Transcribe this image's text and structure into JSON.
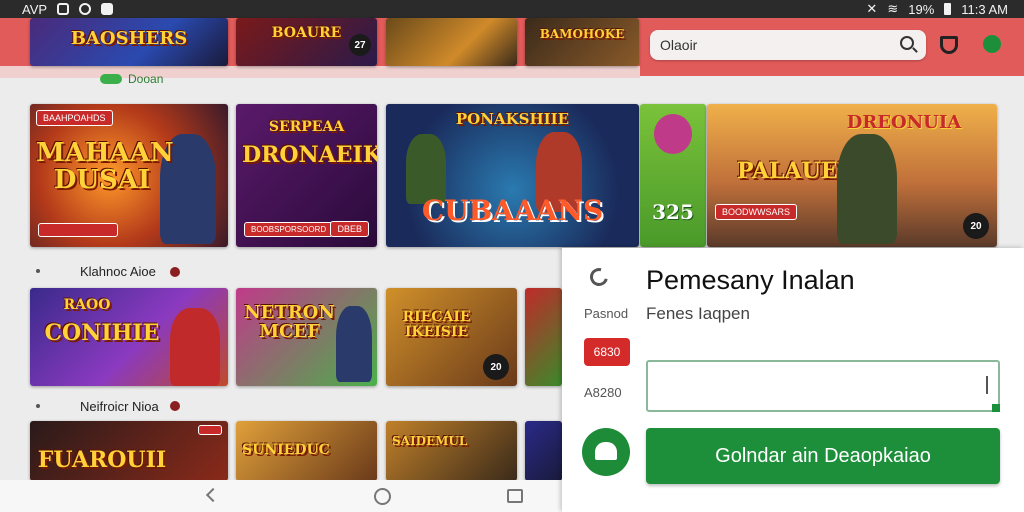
{
  "status_bar": {
    "carrier": "AVP",
    "battery": "19%",
    "time": "11:3 AM"
  },
  "header": {
    "search_placeholder": "Olaoir"
  },
  "featured_label": "Dooan",
  "top_row": [
    {
      "title": "BAOSHERS",
      "tag": "",
      "badge": ""
    },
    {
      "title": "BOAURE",
      "tag": "",
      "badge": "27"
    },
    {
      "title": "",
      "tag": "",
      "badge": ""
    },
    {
      "title": "BAMOHOKE",
      "tag": "",
      "badge": ""
    }
  ],
  "hero_row": [
    {
      "title": "MAHAAN DUSAI",
      "tag": "BAAHPOAHDS",
      "badge": ""
    },
    {
      "title": "DRONAEIK",
      "sub": "SERPEAA",
      "tag": "BOOBSPORSOORD",
      "badge": "DBEB"
    },
    {
      "title": "CUBAAANS",
      "sub": "PONAKSHIIE",
      "tag": "",
      "badge": ""
    },
    {
      "title": "325",
      "tag": "",
      "badge": ""
    },
    {
      "title": "PALAUEI",
      "sub": "DREONUIA",
      "tag": "BOODWWSARS",
      "badge": "20"
    }
  ],
  "section1": {
    "label": "Klahnoc Aioe"
  },
  "row1": [
    {
      "title": "CONIHIE",
      "sub": "RAOO",
      "badge": ""
    },
    {
      "title": "NETRON MCEF",
      "sub": "",
      "badge": ""
    },
    {
      "title": "RIECAIE IKEISIE",
      "sub": "",
      "badge": "20"
    },
    {
      "title": "",
      "sub": "",
      "badge": ""
    }
  ],
  "section2": {
    "label": "Neifroicr Nioa"
  },
  "row2": [
    {
      "title": "FUAROUII",
      "sub": ""
    },
    {
      "title": "SUNIEDUC",
      "sub": ""
    },
    {
      "title": "SAIDEMUL",
      "sub": ""
    },
    {
      "title": "",
      "sub": ""
    }
  ],
  "panel": {
    "title": "Pemesany Inalan",
    "label1": "Pasnod",
    "subtitle": "Fenes Iaqpen",
    "badge": "6830",
    "label2": "A8280",
    "button": "Golndar ain Deaopkaiao"
  },
  "colors": {
    "brand_red": "#e25b5b",
    "accent_green": "#1d8f3a",
    "badge_red": "#d42a2a"
  }
}
